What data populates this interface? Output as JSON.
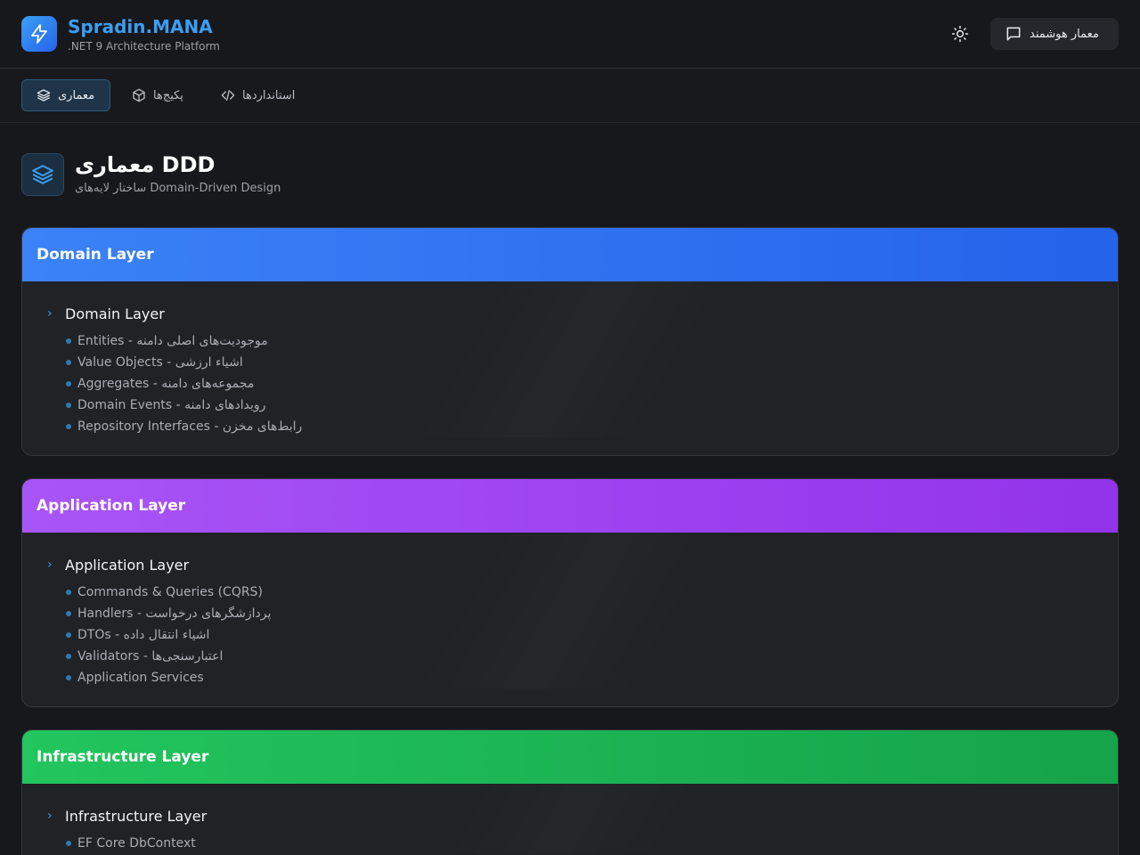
{
  "header": {
    "brand_title": "Spradin.MANA",
    "brand_subtitle": ".NET 9 Architecture Platform",
    "ai_button_label": "معمار هوشمند",
    "theme_toggle_icon": "sun-icon"
  },
  "nav": {
    "items": [
      {
        "label": "معماری",
        "icon": "layers-icon",
        "active": true
      },
      {
        "label": "پکیج‌ها",
        "icon": "package-icon",
        "active": false
      },
      {
        "label": "استانداردها",
        "icon": "code-icon",
        "active": false
      }
    ]
  },
  "page": {
    "title": "معماری DDD",
    "subtitle": "ساختار لایه‌های Domain-Driven Design",
    "icon": "layers-icon"
  },
  "colors": {
    "domain": [
      "#3b82f6",
      "#2563eb"
    ],
    "application": [
      "#a855f7",
      "#9333ea"
    ],
    "infrastructure": [
      "#22c55e",
      "#16a34a"
    ],
    "accent": "#3b9ef2"
  },
  "layers": [
    {
      "header": "Domain Layer",
      "section_title": "Domain Layer",
      "items": [
        "Entities - موجودیت‌های اصلی دامنه",
        "Value Objects - اشیاء ارزشی",
        "Aggregates - مجموعه‌های دامنه",
        "Domain Events - رویدادهای دامنه",
        "Repository Interfaces - رابط‌های مخزن"
      ]
    },
    {
      "header": "Application Layer",
      "section_title": "Application Layer",
      "items": [
        "Commands & Queries (CQRS)",
        "Handlers - پردازشگرهای درخواست",
        "DTOs - اشیاء انتقال داده",
        "Validators - اعتبارسنجی‌ها",
        "Application Services"
      ]
    },
    {
      "header": "Infrastructure Layer",
      "section_title": "Infrastructure Layer",
      "items": [
        "EF Core DbContext"
      ]
    }
  ]
}
